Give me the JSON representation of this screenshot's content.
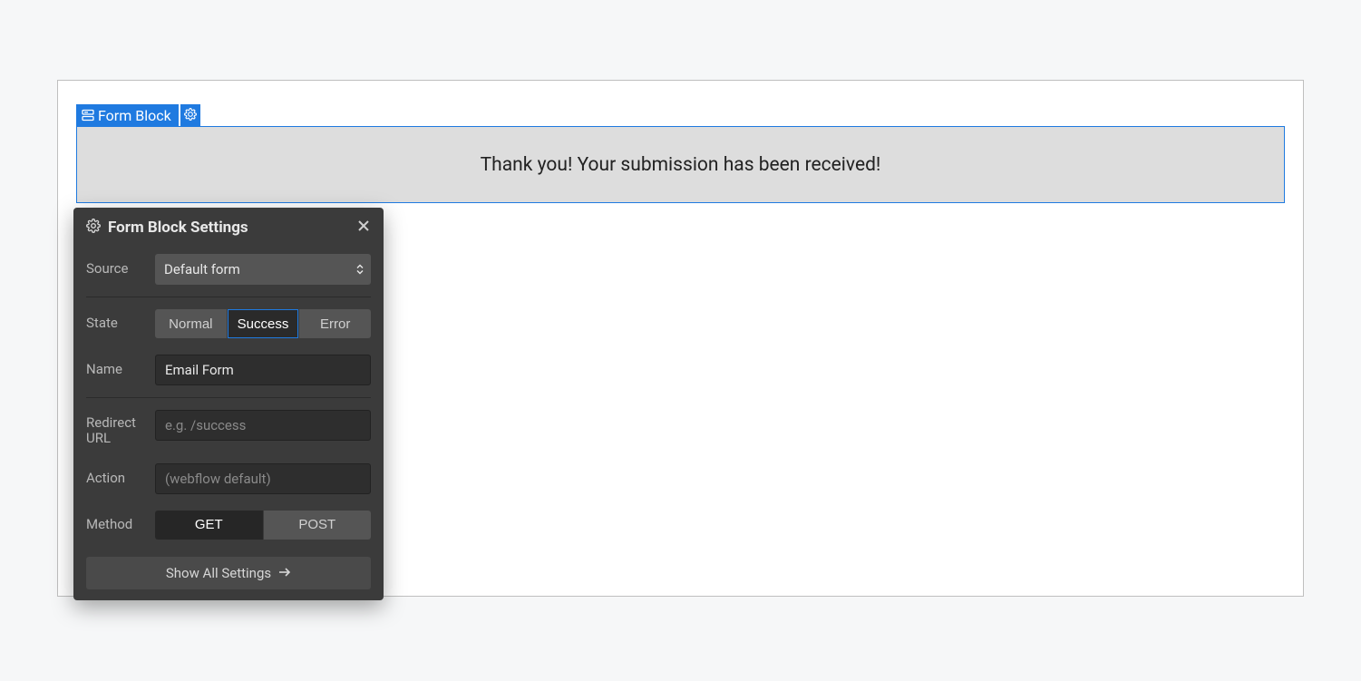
{
  "block": {
    "label": "Form Block",
    "success_message": "Thank you! Your submission has been received!"
  },
  "panel": {
    "title": "Form Block Settings",
    "source_label": "Source",
    "source_value": "Default form",
    "state_label": "State",
    "state_options": {
      "normal": "Normal",
      "success": "Success",
      "error": "Error"
    },
    "name_label": "Name",
    "name_value": "Email Form",
    "redirect_label": "Redirect URL",
    "redirect_placeholder": "e.g. /success",
    "action_label": "Action",
    "action_placeholder": "(webflow default)",
    "method_label": "Method",
    "method_options": {
      "get": "GET",
      "post": "POST"
    },
    "show_all": "Show All Settings"
  }
}
